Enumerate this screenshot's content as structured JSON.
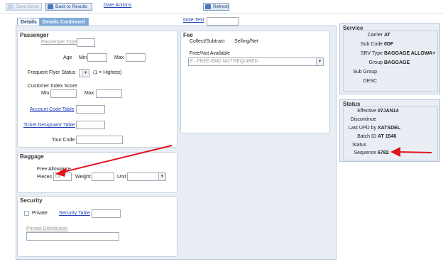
{
  "toolbar": {
    "save_done": "Save-Done",
    "back": "Back to Results",
    "date_actions": "Date Actions",
    "refresh": "Refresh"
  },
  "tabs": {
    "details": "Details",
    "details_continued": "Details Continued"
  },
  "note_text_label": "Note Text",
  "passenger": {
    "title": "Passenger",
    "passenger_type": "Passenger Type",
    "age": "Age",
    "min": "Min",
    "max": "Max",
    "frequent_flyer_status": "Frequent Flyer Status",
    "ff_hint": "(1 = Highest)",
    "customer_index_score": "Customer Index Score",
    "account_code_table": "Account Code Table",
    "ticket_designator_table": "Ticket Designator Table",
    "tour_code": "Tour Code"
  },
  "fee": {
    "title": "Fee",
    "collect_subtract": "Collect/Subtract",
    "selling_net": "Selling/Net",
    "free_not_available": "Free/Not Available",
    "free_value": "F - FREE-EMD NOT REQUIRED"
  },
  "baggage": {
    "title": "Baggage",
    "free_allowance": "Free Allowance",
    "pieces": "Pieces",
    "pieces_value": "02",
    "weight": "Weight",
    "unit": "Unit"
  },
  "security": {
    "title": "Security",
    "private": "Private",
    "security_table": "Security Table",
    "private_distribution": "Private Distribution"
  },
  "service": {
    "title": "Service",
    "carrier_label": "Carrier",
    "carrier": "AT",
    "sub_code_label": "Sub Code",
    "sub_code": "0DF",
    "srv_type_label": "SRV Type",
    "srv_type": "BAGGAGE ALLOWA+",
    "group_label": "Group",
    "group": "BAGGAGE",
    "sub_group_label": "Sub Group",
    "desc_label": "DESC"
  },
  "status": {
    "title": "Status",
    "effective_label": "Effective",
    "effective": "07JAN14",
    "discontinue_label": "Discontinue",
    "last_upd_label": "Last UPD by",
    "last_upd": "XATSDEL",
    "batch_label": "Batch ID",
    "batch": "AT 1546",
    "status_label": "Status",
    "sequence_label": "Sequence",
    "sequence": "6782"
  },
  "colors": {
    "arrow": "#e0141c",
    "tab_inactive": "#7aa7d8",
    "panel_bg": "#e9eef5"
  }
}
